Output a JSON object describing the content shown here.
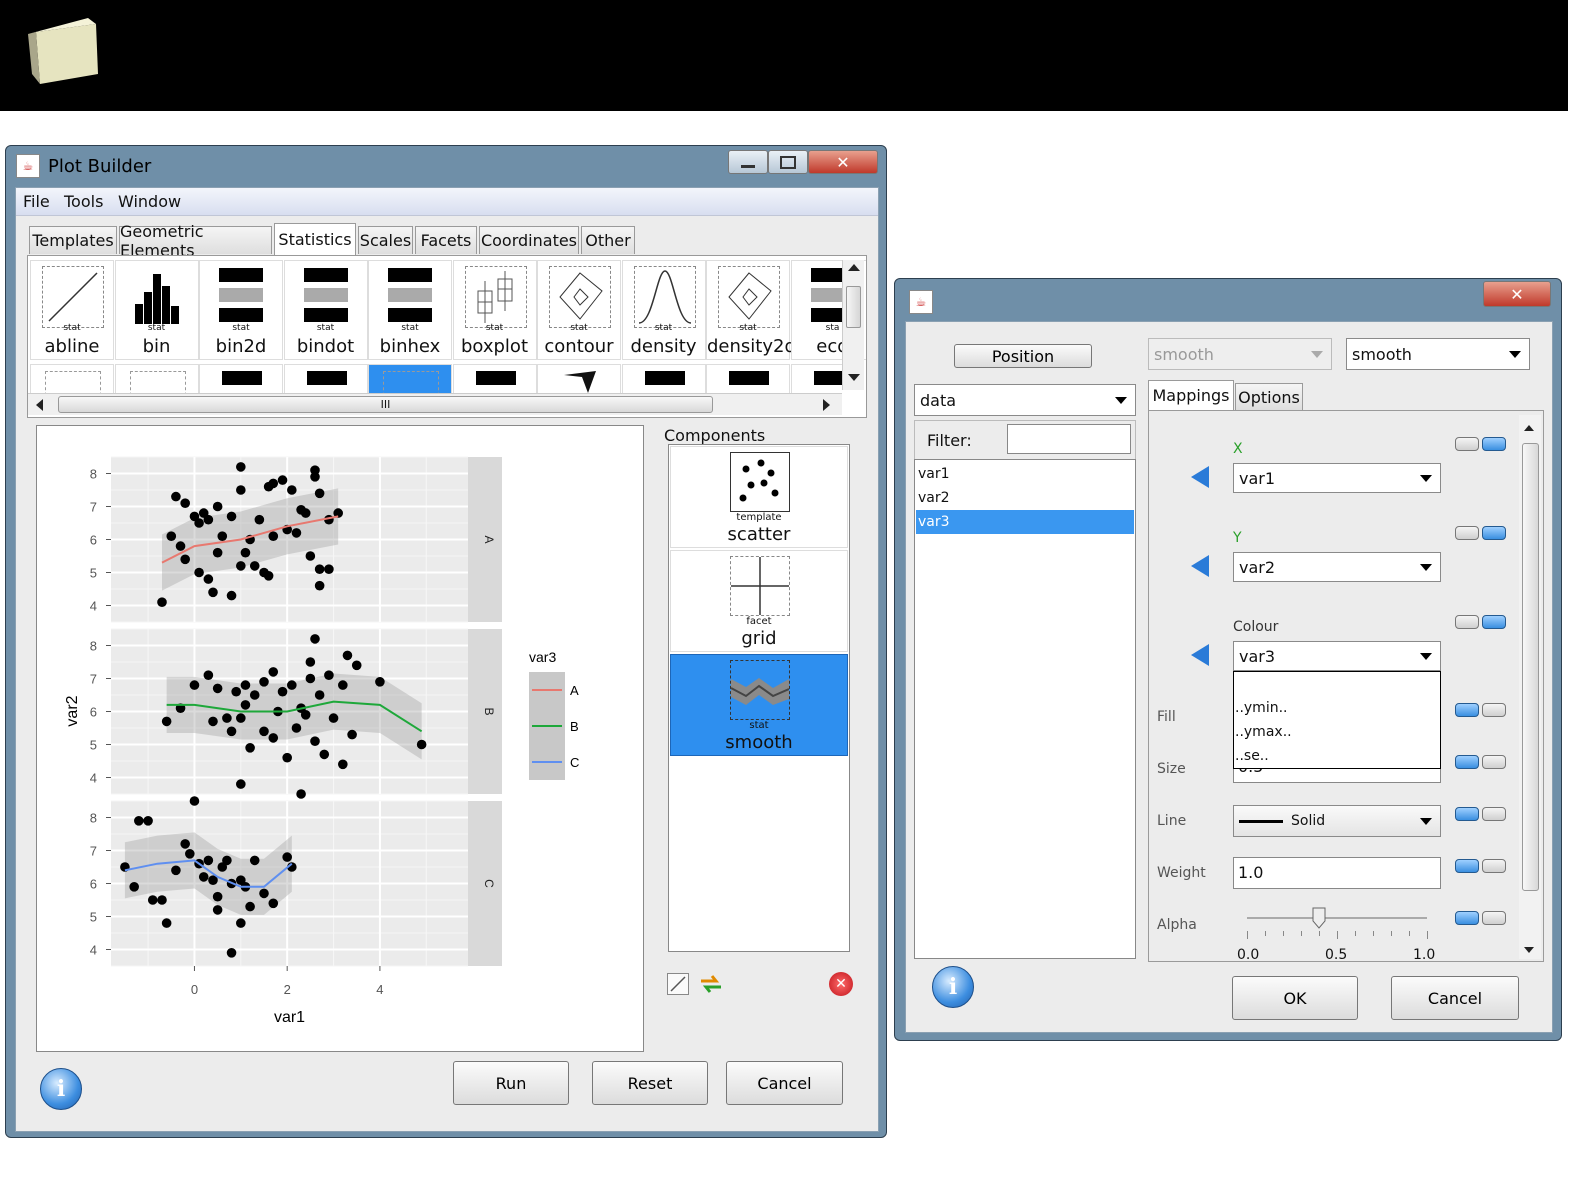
{
  "plot_builder": {
    "title": "Plot Builder",
    "menu": [
      "File",
      "Tools",
      "Window"
    ],
    "tabs": [
      "Templates",
      "Geometric Elements",
      "Statistics",
      "Scales",
      "Facets",
      "Coordinates",
      "Other"
    ],
    "active_tab": "Statistics",
    "stat_tiles": [
      {
        "tag": "stat",
        "label": "abline"
      },
      {
        "tag": "stat",
        "label": "bin"
      },
      {
        "tag": "stat",
        "label": "bin2d"
      },
      {
        "tag": "stat",
        "label": "bindot"
      },
      {
        "tag": "stat",
        "label": "binhex"
      },
      {
        "tag": "stat",
        "label": "boxplot"
      },
      {
        "tag": "stat",
        "label": "contour"
      },
      {
        "tag": "stat",
        "label": "density"
      },
      {
        "tag": "stat",
        "label": "density2d"
      },
      {
        "tag": "sta",
        "label": "ecd"
      }
    ],
    "components_label": "Components",
    "components": [
      {
        "tag": "template",
        "label": "scatter"
      },
      {
        "tag": "facet",
        "label": "grid"
      },
      {
        "tag": "stat",
        "label": "smooth"
      }
    ],
    "buttons": {
      "run": "Run",
      "reset": "Reset",
      "cancel": "Cancel"
    }
  },
  "chart_data": {
    "type": "scatter",
    "xlabel": "var1",
    "ylabel": "var2",
    "x_ticks": [
      "0",
      "2",
      "4"
    ],
    "y_ticks": [
      "4",
      "5",
      "6",
      "7",
      "8"
    ],
    "xlim": [
      -1.8,
      5.9
    ],
    "ylim": [
      3.5,
      8.5
    ],
    "legend_title": "var3",
    "legend_position": "right",
    "facets": [
      {
        "name": "A",
        "color": "#e8786f",
        "points": [
          [
            -0.7,
            4.1
          ],
          [
            -0.4,
            7.3
          ],
          [
            -0.2,
            7.1
          ],
          [
            0.0,
            6.7
          ],
          [
            0.1,
            6.5
          ],
          [
            0.2,
            6.8
          ],
          [
            0.3,
            6.6
          ],
          [
            0.5,
            7.0
          ],
          [
            0.6,
            6.1
          ],
          [
            0.8,
            6.7
          ],
          [
            1.0,
            7.5
          ],
          [
            1.2,
            6.0
          ],
          [
            1.4,
            6.6
          ],
          [
            1.6,
            7.6
          ],
          [
            1.7,
            7.7
          ],
          [
            1.9,
            7.8
          ],
          [
            2.1,
            7.5
          ],
          [
            2.4,
            6.8
          ],
          [
            2.6,
            7.9
          ],
          [
            2.7,
            7.4
          ],
          [
            2.9,
            6.6
          ],
          [
            3.1,
            6.8
          ],
          [
            -0.5,
            6.1
          ],
          [
            -0.2,
            5.4
          ],
          [
            0.1,
            5.0
          ],
          [
            0.3,
            4.8
          ],
          [
            0.5,
            5.6
          ],
          [
            0.8,
            4.3
          ],
          [
            1.0,
            5.2
          ],
          [
            1.3,
            5.2
          ],
          [
            1.5,
            5.0
          ],
          [
            1.7,
            6.1
          ],
          [
            2.0,
            6.3
          ],
          [
            2.2,
            6.2
          ],
          [
            2.5,
            5.5
          ],
          [
            2.7,
            4.6
          ],
          [
            2.9,
            5.1
          ],
          [
            -0.3,
            5.8
          ],
          [
            0.4,
            4.4
          ],
          [
            1.1,
            5.6
          ],
          [
            1.6,
            4.9
          ],
          [
            2.3,
            6.9
          ],
          [
            2.7,
            5.1
          ],
          [
            1.0,
            8.2
          ],
          [
            2.6,
            8.1
          ]
        ],
        "line": [
          [
            -0.7,
            5.3
          ],
          [
            0,
            5.8
          ],
          [
            1,
            6.0
          ],
          [
            2,
            6.4
          ],
          [
            3.1,
            6.7
          ]
        ]
      },
      {
        "name": "B",
        "color": "#1ea83a",
        "points": [
          [
            -0.6,
            5.7
          ],
          [
            -0.3,
            6.1
          ],
          [
            0.0,
            6.8
          ],
          [
            0.3,
            7.1
          ],
          [
            0.5,
            6.7
          ],
          [
            0.7,
            5.8
          ],
          [
            0.9,
            6.6
          ],
          [
            1.1,
            6.8
          ],
          [
            1.3,
            6.5
          ],
          [
            1.5,
            6.9
          ],
          [
            1.7,
            7.2
          ],
          [
            1.9,
            6.6
          ],
          [
            2.1,
            6.8
          ],
          [
            2.3,
            6.1
          ],
          [
            2.5,
            7.0
          ],
          [
            2.7,
            6.5
          ],
          [
            2.9,
            7.1
          ],
          [
            3.2,
            6.8
          ],
          [
            3.3,
            7.7
          ],
          [
            3.5,
            7.4
          ],
          [
            4.0,
            6.9
          ],
          [
            4.9,
            5.0
          ],
          [
            0.4,
            5.7
          ],
          [
            0.8,
            5.4
          ],
          [
            1.0,
            5.8
          ],
          [
            1.2,
            4.9
          ],
          [
            1.5,
            5.4
          ],
          [
            1.7,
            5.2
          ],
          [
            2.0,
            4.6
          ],
          [
            2.2,
            5.5
          ],
          [
            2.4,
            5.9
          ],
          [
            2.6,
            5.1
          ],
          [
            2.8,
            4.7
          ],
          [
            3.0,
            5.8
          ],
          [
            3.2,
            4.4
          ],
          [
            3.4,
            5.3
          ],
          [
            1.0,
            3.8
          ],
          [
            2.3,
            3.5
          ],
          [
            2.6,
            8.2
          ],
          [
            2.5,
            7.5
          ],
          [
            1.8,
            6.0
          ],
          [
            1.1,
            6.2
          ]
        ],
        "line": [
          [
            -0.6,
            6.2
          ],
          [
            0,
            6.2
          ],
          [
            1,
            6.0
          ],
          [
            2,
            6.0
          ],
          [
            3,
            6.3
          ],
          [
            4,
            6.2
          ],
          [
            4.9,
            5.4
          ]
        ]
      },
      {
        "name": "C",
        "color": "#5f8ff0",
        "points": [
          [
            -1.5,
            6.5
          ],
          [
            -1.3,
            5.9
          ],
          [
            -1.2,
            7.9
          ],
          [
            -1.0,
            7.9
          ],
          [
            -0.9,
            5.5
          ],
          [
            -0.7,
            5.5
          ],
          [
            -0.6,
            4.8
          ],
          [
            -0.4,
            6.4
          ],
          [
            -0.2,
            7.2
          ],
          [
            -0.1,
            6.9
          ],
          [
            0.0,
            8.5
          ],
          [
            0.1,
            6.6
          ],
          [
            0.3,
            6.7
          ],
          [
            0.4,
            6.1
          ],
          [
            0.5,
            5.6
          ],
          [
            0.6,
            6.5
          ],
          [
            0.7,
            6.7
          ],
          [
            0.8,
            6.0
          ],
          [
            1.0,
            6.1
          ],
          [
            1.1,
            5.9
          ],
          [
            1.2,
            5.3
          ],
          [
            1.3,
            6.7
          ],
          [
            1.5,
            5.7
          ],
          [
            1.7,
            5.4
          ],
          [
            0.5,
            5.2
          ],
          [
            0.8,
            3.9
          ],
          [
            1.0,
            4.8
          ],
          [
            2.0,
            6.8
          ],
          [
            2.1,
            6.5
          ],
          [
            0.2,
            6.2
          ]
        ],
        "line": [
          [
            -1.5,
            6.4
          ],
          [
            -0.8,
            6.6
          ],
          [
            0,
            6.7
          ],
          [
            0.5,
            6.2
          ],
          [
            1.0,
            5.9
          ],
          [
            1.5,
            5.9
          ],
          [
            2.1,
            6.6
          ]
        ]
      }
    ]
  },
  "dialog": {
    "position_button": "Position",
    "geom_combo": "smooth",
    "stat_combo": "smooth",
    "data_combo": "data",
    "filter_label": "Filter:",
    "filter_value": "",
    "variables": [
      "var1",
      "var2",
      "var3"
    ],
    "selected_variable": "var3",
    "tabs": [
      "Mappings",
      "Options"
    ],
    "active_tab": "Mappings",
    "x_label": "X",
    "x_value": "var1",
    "y_label": "Y",
    "y_value": "var2",
    "colour_label": "Colour",
    "colour_value": "var3",
    "colour_options": [
      "..ymin..",
      "..ymax..",
      "..se.."
    ],
    "fill_label": "Fill",
    "size_label": "Size",
    "size_value": "0.5",
    "line_label": "Line",
    "line_value": "Solid",
    "weight_label": "Weight",
    "weight_value": "1.0",
    "alpha_label": "Alpha",
    "alpha_value": 0.4,
    "alpha_ticks": [
      "0.0",
      "0.5",
      "1.0"
    ],
    "ok": "OK",
    "cancel": "Cancel",
    "accent_green": "#2aa02a"
  }
}
